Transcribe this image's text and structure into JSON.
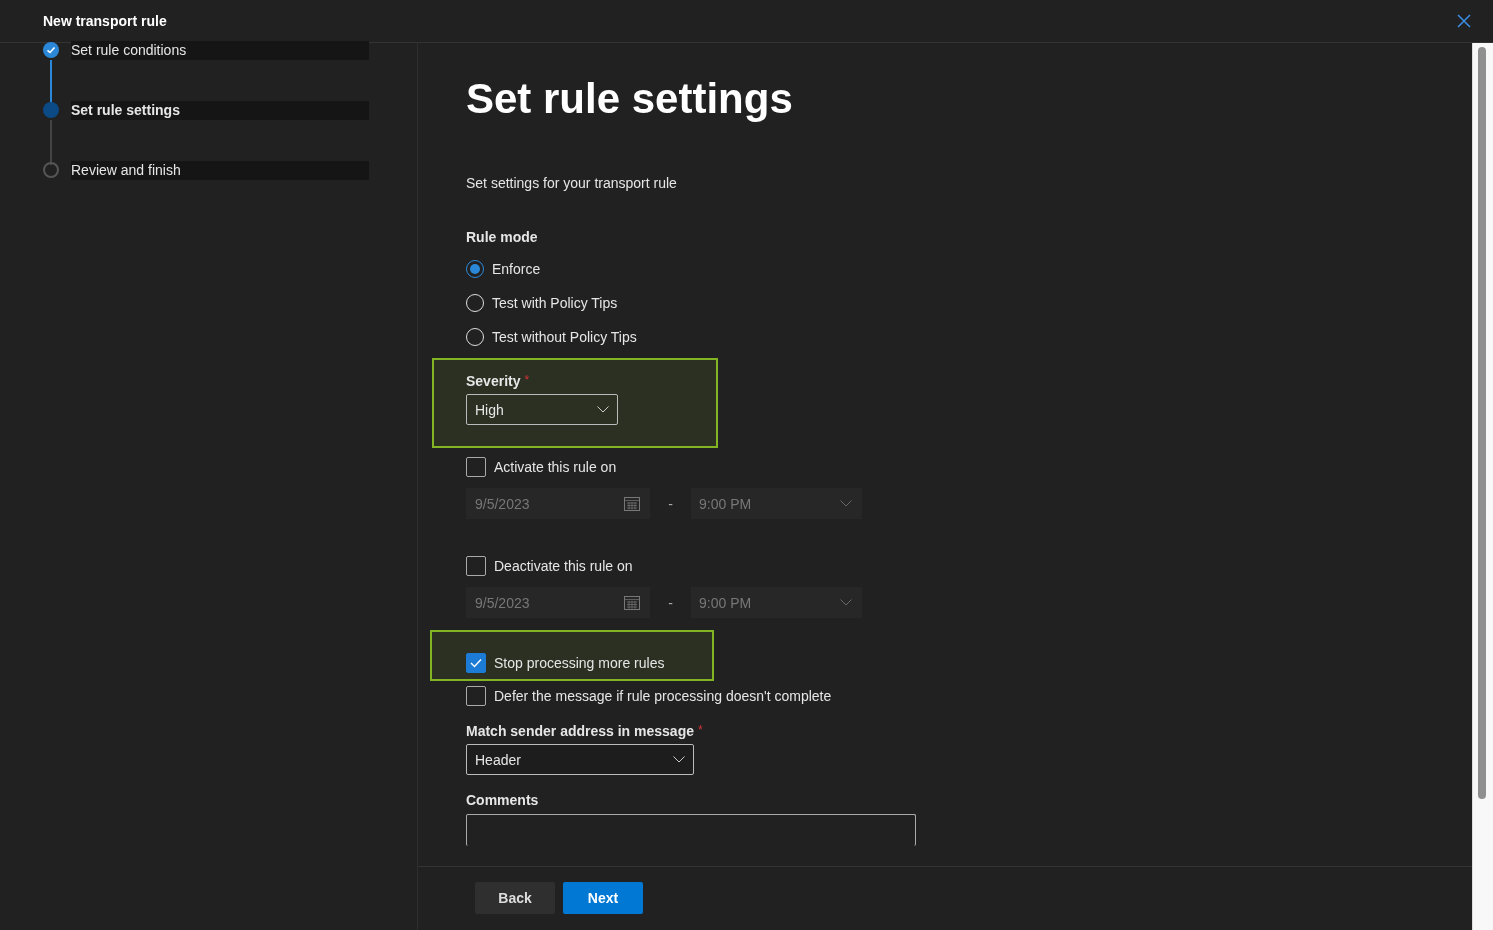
{
  "dialog": {
    "title": "New transport rule"
  },
  "steps": [
    {
      "label": "Set rule conditions",
      "completed": true,
      "selected": false
    },
    {
      "label": "Set rule settings",
      "completed": false,
      "selected": true
    },
    {
      "label": "Review and finish",
      "completed": false,
      "selected": false
    }
  ],
  "page": {
    "heading": "Set rule settings",
    "description": "Set settings for your transport rule"
  },
  "rule_mode": {
    "label": "Rule mode",
    "options": [
      {
        "label": "Enforce",
        "selected": true
      },
      {
        "label": "Test with Policy Tips",
        "selected": false
      },
      {
        "label": "Test without Policy Tips",
        "selected": false
      }
    ]
  },
  "severity": {
    "label": "Severity",
    "required_mark": "*",
    "value": "High",
    "highlighted": true
  },
  "schedules": [
    {
      "label": "Activate this rule on",
      "checked": false,
      "date": "9/5/2023",
      "separator": "-",
      "time": "9:00 PM"
    },
    {
      "label": "Deactivate this rule on",
      "checked": false,
      "date": "9/5/2023",
      "separator": "-",
      "time": "9:00 PM"
    }
  ],
  "options": [
    {
      "label": "Stop processing more rules",
      "checked": true,
      "highlighted": true
    },
    {
      "label": "Defer the message if rule processing doesn't complete",
      "checked": false,
      "highlighted": false
    }
  ],
  "match_sender": {
    "label": "Match sender address in message",
    "required_mark": "*",
    "value": "Header"
  },
  "comments": {
    "label": "Comments"
  },
  "buttons": [
    {
      "label": "Back",
      "kind": "secondary"
    },
    {
      "label": "Next",
      "kind": "primary"
    }
  ]
}
